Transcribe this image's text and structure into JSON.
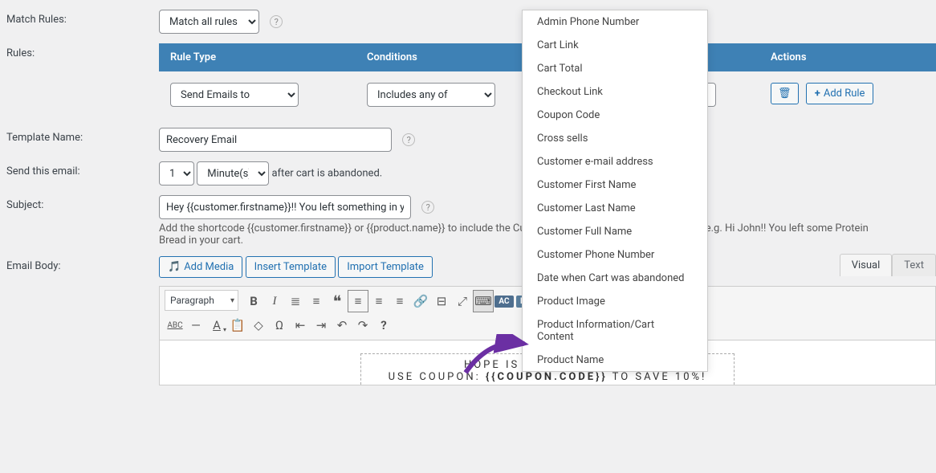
{
  "labels": {
    "match_rules": "Match Rules:",
    "rules": "Rules:",
    "template_name": "Template Name:",
    "send_this_email": "Send this email:",
    "subject": "Subject:",
    "email_body": "Email Body:"
  },
  "match_rules": {
    "selected": "Match all rules"
  },
  "rules_table": {
    "headers": {
      "c1": "Rule Type",
      "c2": "Conditions",
      "c3": "Actions"
    },
    "row": {
      "type": "Send Emails to",
      "cond": "Includes any of"
    },
    "add_rule": "Add Rule"
  },
  "template_name": {
    "value": "Recovery Email"
  },
  "send_email": {
    "qty": "1",
    "unit": "Minute(s)",
    "after": "after cart is abandoned."
  },
  "subject": {
    "value": "Hey {{customer.firstname}}!! You left something in you",
    "hint": "Add the shortcode {{customer.firstname}} or {{product.name}} to include the Custor                                                                         n the cart) to the Subject Line. For e.g. Hi John!! You left some Protein Bread in your cart."
  },
  "body_buttons": {
    "add_media": "Add Media",
    "insert_tpl": "Insert Template",
    "import_tpl": "Import Template"
  },
  "tabs": {
    "visual": "Visual",
    "text": "Text"
  },
  "editor": {
    "para": "Paragraph",
    "buttons_badge": "BUTTONS",
    "ac_badge": "AC"
  },
  "content": {
    "line1": "HOPE IS NOT LOST, YET!",
    "line2a": "USE COUPON: ",
    "line2b": "{{COUPON.CODE}}",
    "line2c": " TO SAVE 10%!"
  },
  "dropdown_items": [
    "Admin Phone Number",
    "Cart Link",
    "Cart Total",
    "Checkout Link",
    "Coupon Code",
    "Cross sells",
    "Customer e-mail address",
    "Customer First Name",
    "Customer Last Name",
    "Customer Full Name",
    "Customer Phone Number",
    "Date when Cart was abandoned",
    "Product Image",
    "Product Information/Cart Content",
    "Product Name"
  ]
}
